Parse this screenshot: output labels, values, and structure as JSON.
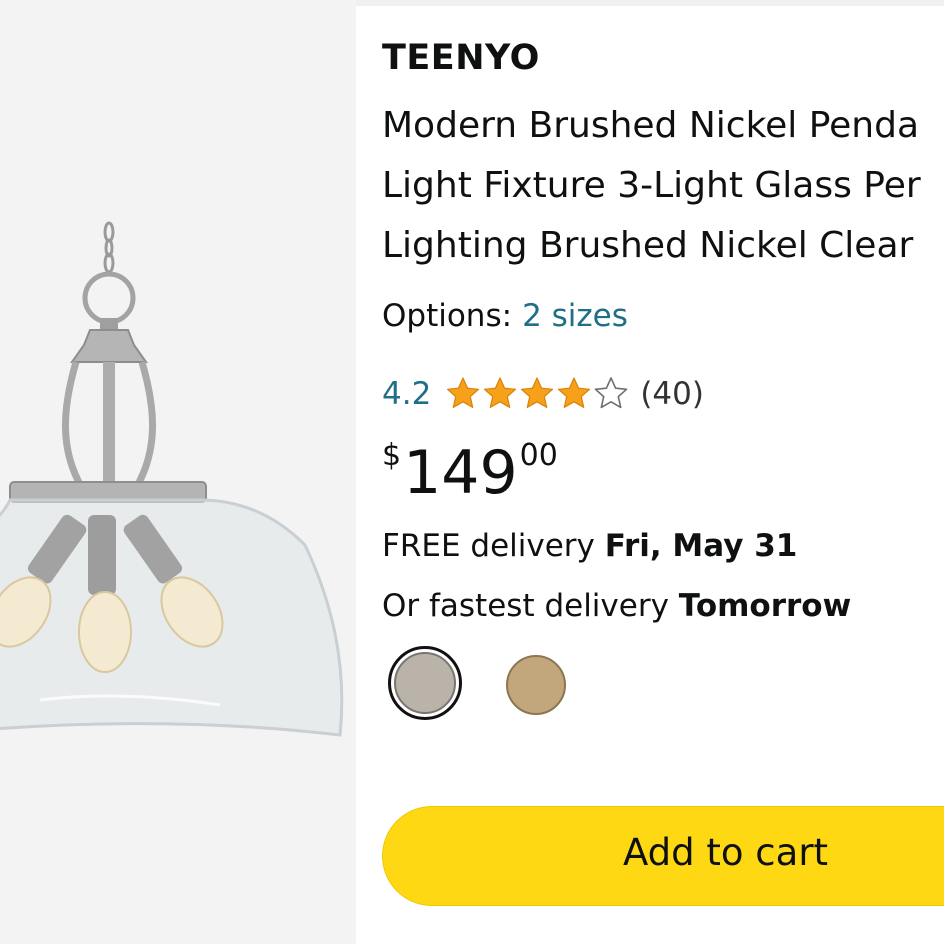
{
  "product": {
    "brand": "TEENYO",
    "title_lines": [
      "Modern Brushed Nickel Penda",
      "Light Fixture 3-Light Glass Per",
      "Lighting Brushed Nickel Clear"
    ]
  },
  "options": {
    "label": "Options:",
    "value": "2 sizes"
  },
  "rating": {
    "score": "4.2",
    "stars_value": 4.2,
    "stars_max": 5,
    "count": "(40)"
  },
  "price": {
    "currency": "$",
    "whole": "149",
    "fraction": "00"
  },
  "delivery": {
    "free_text": "FREE delivery",
    "free_date": "Fri, May 31",
    "fastest_text": "Or fastest delivery",
    "fastest_date": "Tomorrow"
  },
  "swatches": [
    {
      "name": "brushed-nickel",
      "color": "#b9b3aa",
      "selected": true
    },
    {
      "name": "brass",
      "color": "#c3a77c",
      "selected": false
    }
  ],
  "cart": {
    "label": "Add to cart"
  },
  "colors": {
    "link": "#1f6f86",
    "star": "#f7a11a",
    "cart_button": "#ffd814"
  }
}
